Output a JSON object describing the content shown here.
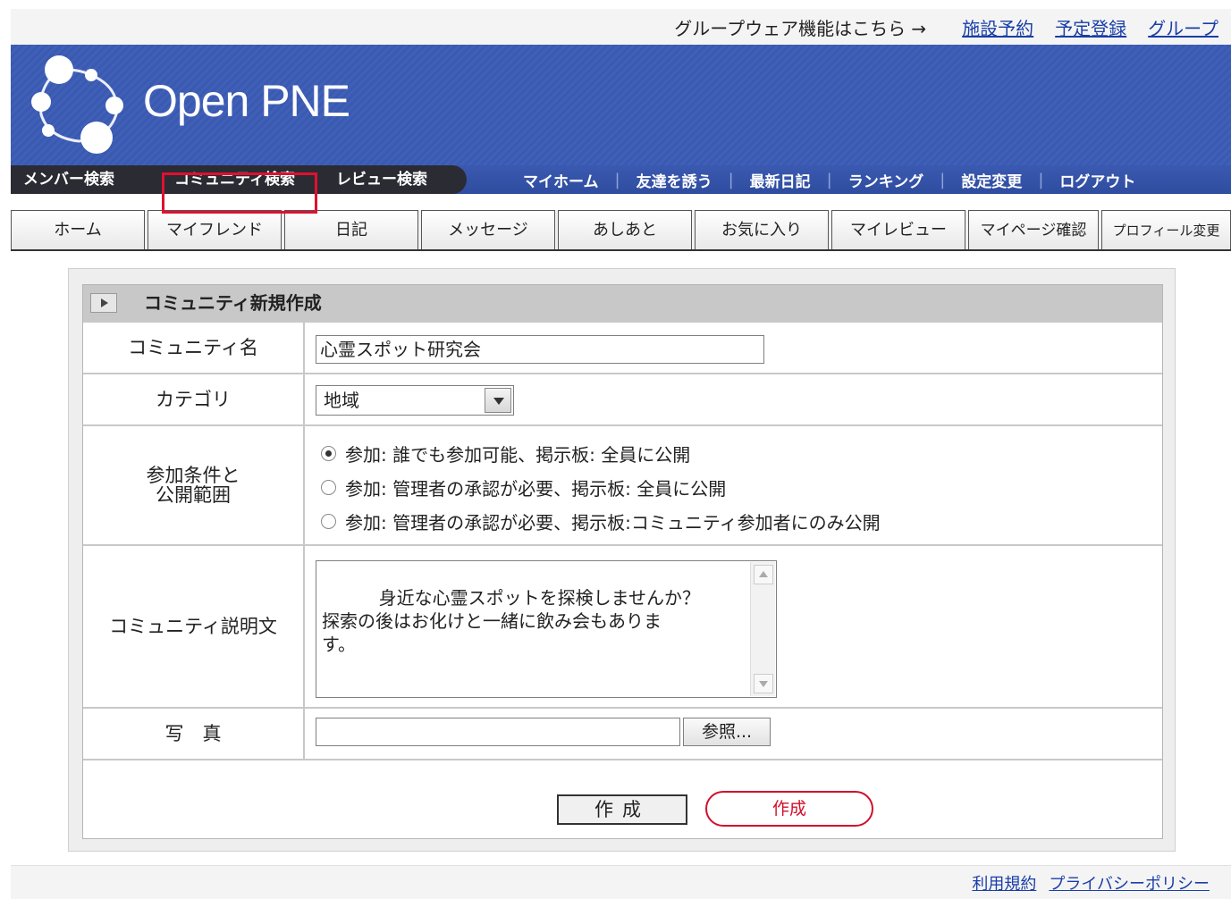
{
  "groupware": {
    "lead": "グループウェア機能はこちら →",
    "links": [
      "施設予約",
      "予定登録",
      "グループ"
    ]
  },
  "header": {
    "logo_text": "Open PNE",
    "logo_icon": "openpne-circles-logo"
  },
  "global_nav": {
    "left_items": [
      "メンバー検索",
      "コミュニティ検索",
      "レビュー検索"
    ],
    "right_items": [
      "マイホーム",
      "友達を誘う",
      "最新日記",
      "ランキング",
      "設定変更",
      "ログアウト"
    ],
    "highlighted": "コミュニティ検索"
  },
  "tabs": [
    "ホーム",
    "マイフレンド",
    "日記",
    "メッセージ",
    "あしあと",
    "お気に入り",
    "マイレビュー",
    "マイページ確認",
    "プロフィール変更"
  ],
  "form": {
    "title": "コミュニティ新規作成",
    "name_label": "コミュニティ名",
    "name_value": "心霊スポット研究会",
    "category_label": "カテゴリ",
    "category_value": "地域",
    "conditions_label_line1": "参加条件と",
    "conditions_label_line2": "公開範囲",
    "conditions_options": [
      "参加: 誰でも参加可能、掲示板: 全員に公開",
      "参加: 管理者の承認が必要、掲示板: 全員に公開",
      "参加: 管理者の承認が必要、掲示板:コミュニティ参加者にのみ公開"
    ],
    "conditions_selected": 0,
    "description_label": "コミュニティ説明文",
    "description_value": "身近な心霊スポットを探検しませんか？\n探索の後はお化けと一緒に飲み会もありま\nす。",
    "photo_label": "写　真",
    "browse_label": "参照...",
    "submit_label": "作成",
    "callout_label": "作成"
  },
  "footer": {
    "links": [
      "利用規約",
      "プライバシーポリシー"
    ]
  },
  "colors": {
    "header_blue": "#3a59b0",
    "nav_dark": "#2b2b34",
    "link_blue": "#1a3ea8",
    "highlight_red": "#e01030"
  }
}
